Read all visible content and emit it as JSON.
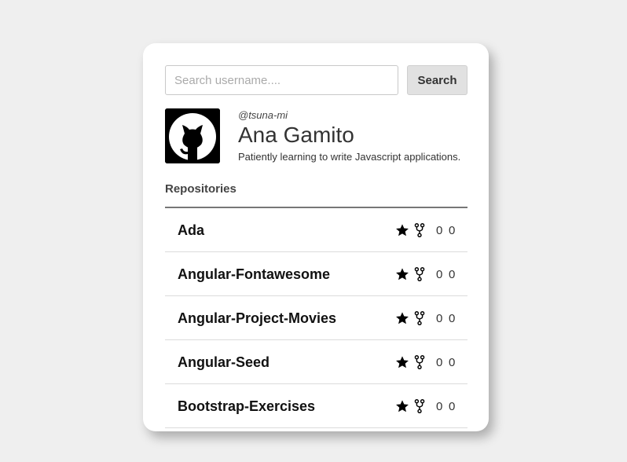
{
  "search": {
    "placeholder": "Search username....",
    "value": "",
    "button_label": "Search"
  },
  "profile": {
    "handle": "@tsuna-mi",
    "name": "Ana Gamito",
    "bio": "Patiently learning to write Javascript applications.",
    "avatar_icon": "github-octocat-icon"
  },
  "repositories": {
    "heading": "Repositories",
    "items": [
      {
        "name": "Ada",
        "stars": "0",
        "forks": "0"
      },
      {
        "name": "Angular-Fontawesome",
        "stars": "0",
        "forks": "0"
      },
      {
        "name": "Angular-Project-Movies",
        "stars": "0",
        "forks": "0"
      },
      {
        "name": "Angular-Seed",
        "stars": "0",
        "forks": "0"
      },
      {
        "name": "Bootstrap-Exercises",
        "stars": "0",
        "forks": "0"
      }
    ]
  },
  "colors": {
    "background": "#efefef",
    "card": "#ffffff",
    "button": "#e1e1e1",
    "text": "#333333"
  }
}
